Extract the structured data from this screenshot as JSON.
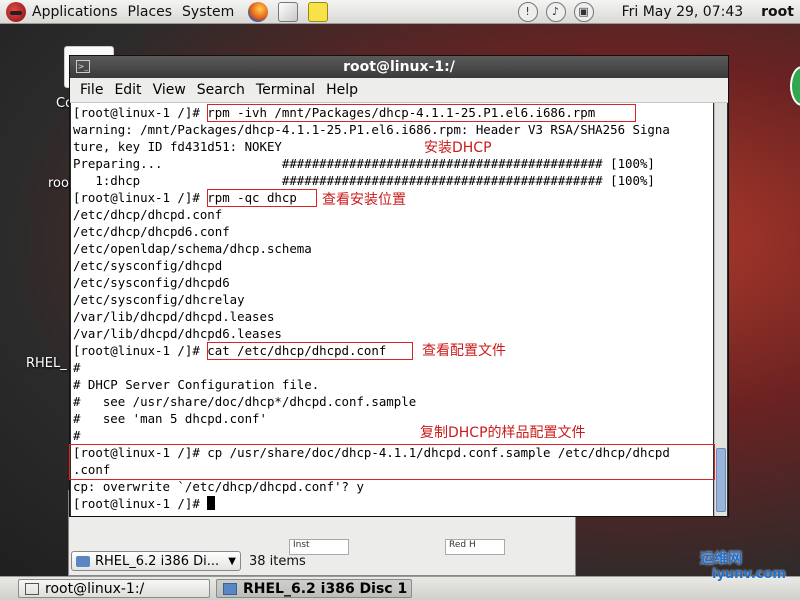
{
  "top_panel": {
    "menus": [
      "Applications",
      "Places",
      "System"
    ],
    "clock": "Fri May 29, 07:43",
    "user": "root"
  },
  "desktop": {
    "labels": [
      "Co",
      "roo",
      "RHEL_"
    ]
  },
  "terminal": {
    "title": "root@linux-1:/",
    "menu": [
      "File",
      "Edit",
      "View",
      "Search",
      "Terminal",
      "Help"
    ],
    "lines": [
      "[root@linux-1 /]# rpm -ivh /mnt/Packages/dhcp-4.1.1-25.P1.el6.i686.rpm",
      "warning: /mnt/Packages/dhcp-4.1.1-25.P1.el6.i686.rpm: Header V3 RSA/SHA256 Signa",
      "ture, key ID fd431d51: NOKEY",
      "Preparing...                ########################################### [100%]",
      "   1:dhcp                   ########################################### [100%]",
      "[root@linux-1 /]# rpm -qc dhcp",
      "/etc/dhcp/dhcpd.conf",
      "/etc/dhcp/dhcpd6.conf",
      "/etc/openldap/schema/dhcp.schema",
      "/etc/sysconfig/dhcpd",
      "/etc/sysconfig/dhcpd6",
      "/etc/sysconfig/dhcrelay",
      "/var/lib/dhcpd/dhcpd.leases",
      "/var/lib/dhcpd/dhcpd6.leases",
      "[root@linux-1 /]# cat /etc/dhcp/dhcpd.conf",
      "#",
      "# DHCP Server Configuration file.",
      "#   see /usr/share/doc/dhcp*/dhcpd.conf.sample",
      "#   see 'man 5 dhcpd.conf'",
      "#",
      "[root@linux-1 /]# cp /usr/share/doc/dhcp-4.1.1/dhcpd.conf.sample /etc/dhcp/dhcpd",
      ".conf",
      "cp: overwrite `/etc/dhcp/dhcpd.conf'? y",
      "[root@linux-1 /]# "
    ]
  },
  "annotations": {
    "install": "安装DHCP",
    "query": "查看安装位置",
    "view": "查看配置文件",
    "copy": "复制DHCP的样品配置文件"
  },
  "file_manager": {
    "location": "RHEL_6.2 i386 Di...",
    "count": "38 items",
    "thumbs": [
      "Inst",
      "Red H"
    ]
  },
  "taskbar": {
    "items": [
      "root@linux-1:/",
      "RHEL_6.2 i386 Disc 1"
    ]
  },
  "watermark": {
    "line1": "运维网",
    "line2": "iyunv.com"
  },
  "colors": {
    "annotation": "#cc1a1a",
    "terminal_bg": "#ffffff",
    "titlebar": "#3a3a3a"
  }
}
